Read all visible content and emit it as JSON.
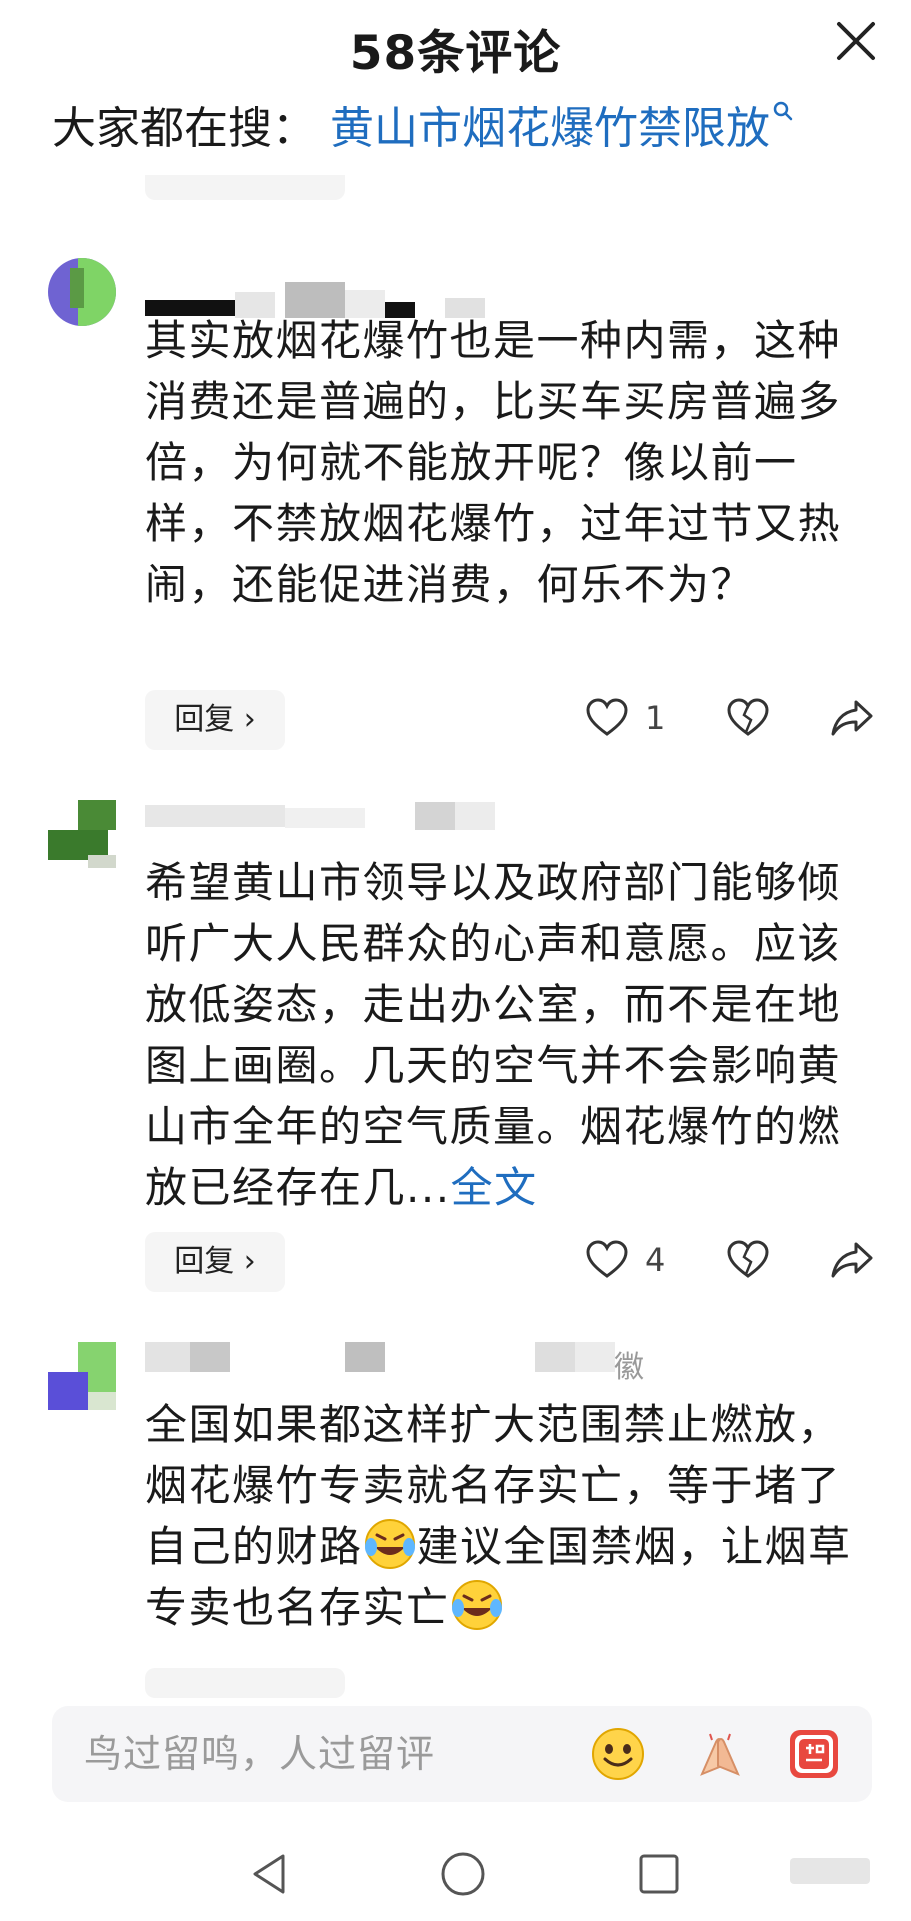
{
  "header": {
    "title": "58条评论",
    "search_label": "大家都在搜：",
    "search_link": "黄山市烟花爆竹禁限放"
  },
  "comments": [
    {
      "text": "其实放烟花爆竹也是一种内需，这种消费还是普遍的，比买车买房普遍多倍，为何就不能放开呢？像以前一样，不禁放烟花爆竹，过年过节又热闹，还能促进消费，何乐不为？",
      "reply_label": "回复",
      "likes": "1"
    },
    {
      "text": "希望黄山市领导以及政府部门能够倾听广大人民群众的心声和意愿。应该放低姿态，走出办公室，而不是在地图上画圈。几天的空气并不会影响黄山市全年的空气质量。烟花爆竹的燃放已经存在几...",
      "more_label": "全文",
      "reply_label": "回复",
      "likes": "4"
    },
    {
      "meta_visible": "徽",
      "text_part1": "全国如果都这样扩大范围禁止燃放，烟花爆竹专卖就名存实亡，等于堵了自己的财路",
      "text_part2": "建议全国禁烟，让烟草专卖也名存实亡"
    }
  ],
  "input": {
    "placeholder": "鸟过留鸣，人过留评"
  },
  "icons": {
    "heart": "heart-outline-icon",
    "dislike": "broken-heart-icon",
    "share": "share-arrow-icon",
    "emoji": "smiley-emoji-icon",
    "applause": "clapping-hands-icon",
    "cheer": "jiayou-badge-icon"
  },
  "colors": {
    "link": "#1f6dbf",
    "text": "#1a1a1a",
    "placeholder": "#9a9a9a"
  }
}
